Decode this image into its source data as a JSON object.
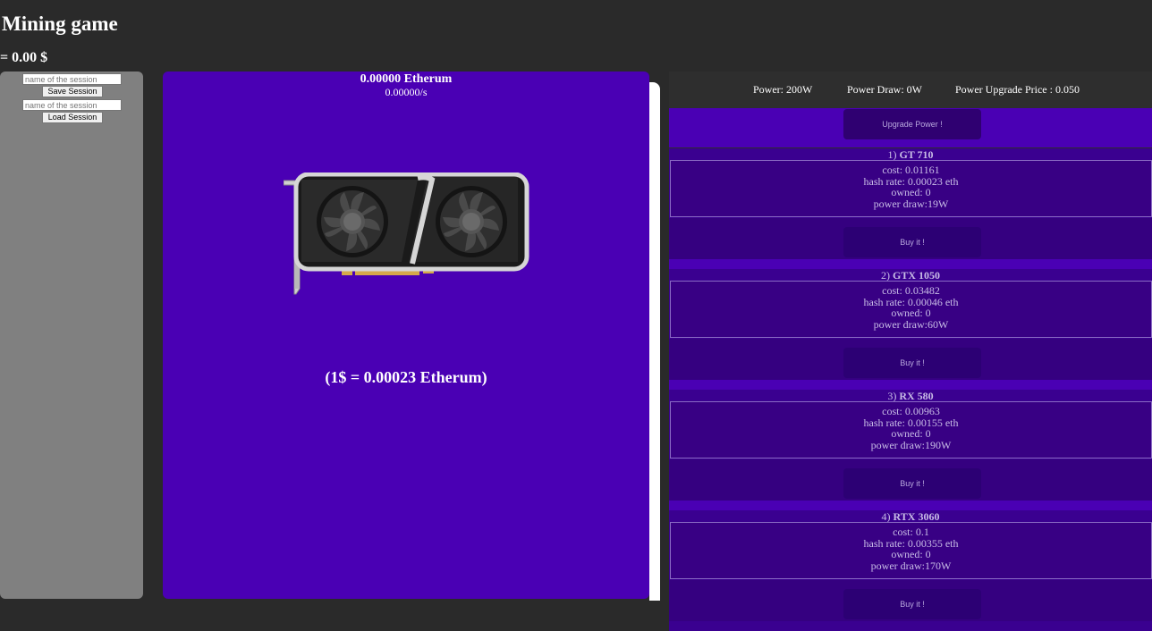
{
  "app": {
    "title": "Mining game",
    "balance": "= 0.00 $"
  },
  "session": {
    "name_placeholder": "name of the session",
    "save_label": "Save Session",
    "load_placeholder": "name of the session",
    "load_label": "Load Session"
  },
  "mining": {
    "eth_amount": "0.00000 Etherum",
    "eth_rate": "0.00000/s",
    "exchange_rate": "(1$ = 0.00023 Etherum)"
  },
  "power": {
    "power": "Power: 200W",
    "draw": "Power Draw: 0W",
    "upgrade_price": "Power Upgrade Price : 0.050",
    "upgrade_label": "Upgrade Power !"
  },
  "shop": {
    "items": [
      {
        "index": "1)",
        "name": "GT 710",
        "cost": "cost: 0.01161",
        "hash": "hash rate: 0.00023 eth",
        "owned": "owned: 0",
        "draw": "power draw:19W",
        "buy_label": "Buy it !"
      },
      {
        "index": "2)",
        "name": "GTX 1050",
        "cost": "cost: 0.03482",
        "hash": "hash rate: 0.00046 eth",
        "owned": "owned: 0",
        "draw": "power draw:60W",
        "buy_label": "Buy it !"
      },
      {
        "index": "3)",
        "name": "RX 580",
        "cost": "cost: 0.00963",
        "hash": "hash rate: 0.00155 eth",
        "owned": "owned: 0",
        "draw": "power draw:190W",
        "buy_label": "Buy it !"
      },
      {
        "index": "4)",
        "name": "RTX 3060",
        "cost": "cost: 0.1",
        "hash": "hash rate: 0.00355 eth",
        "owned": "owned: 0",
        "draw": "power draw:170W",
        "buy_label": "Buy it !"
      }
    ]
  },
  "colors": {
    "page_bg": "#2a2a2a",
    "session_panel": "#808080",
    "mining_panel": "#4a00b4",
    "shop_item": "#3a0090",
    "shop_button": "#2c0074"
  },
  "icons": {
    "gpu": "graphics-card-icon"
  }
}
